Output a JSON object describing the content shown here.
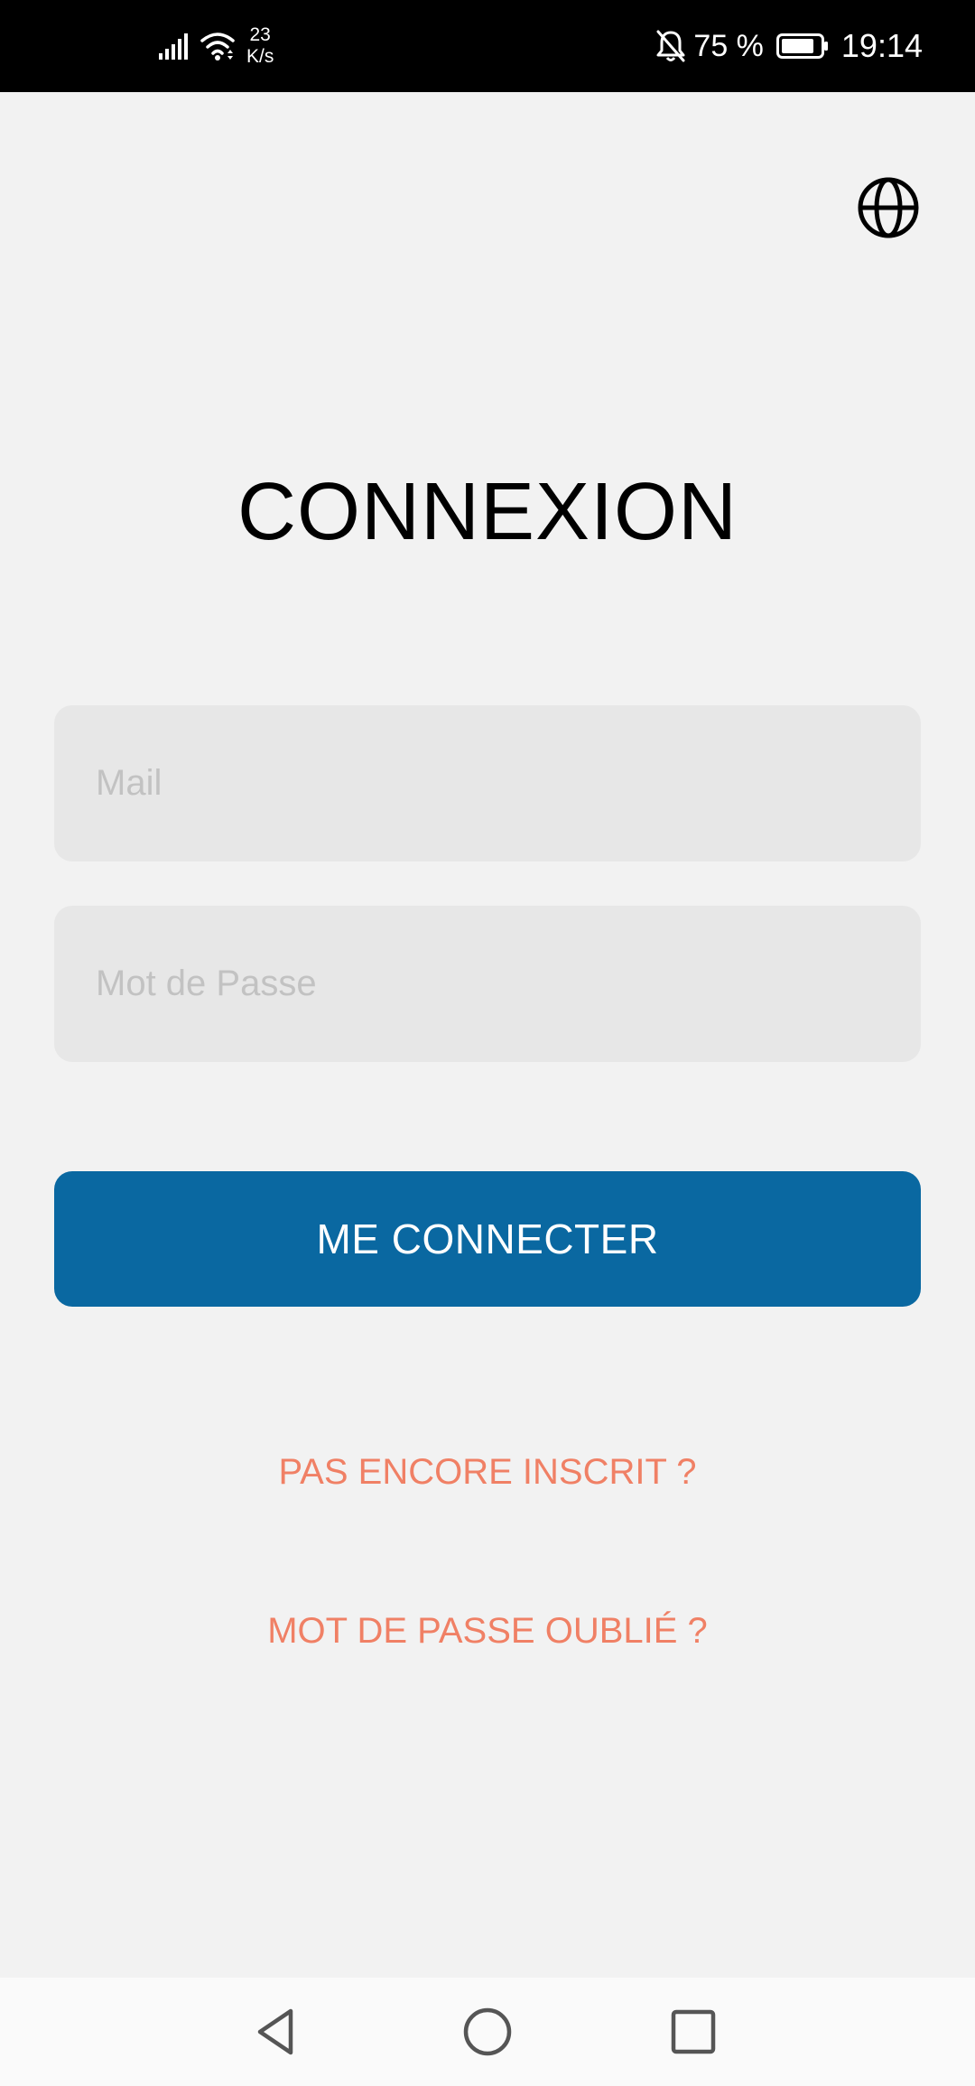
{
  "status_bar": {
    "signal_icon": "cellular-signal-icon",
    "wifi_icon": "wifi-icon",
    "net_speed_value": "23",
    "net_speed_unit": "K/s",
    "mute_icon": "notifications-off-icon",
    "battery_percent": "75 %",
    "battery_icon": "battery-icon",
    "time": "19:14"
  },
  "header": {
    "language_icon": "globe-icon"
  },
  "login": {
    "title": "CONNEXION",
    "email_placeholder": "Mail",
    "email_value": "",
    "password_placeholder": "Mot de Passe",
    "password_value": "",
    "submit_label": "ME CONNECTER",
    "register_link": "PAS ENCORE INSCRIT ?",
    "forgot_link": "MOT DE PASSE OUBLIÉ ?"
  },
  "colors": {
    "background": "#f2f2f2",
    "input_background": "#e7e7e7",
    "placeholder": "#c2c2c2",
    "primary_button": "#0a68a1",
    "link": "#f08065",
    "status_bar": "#000000"
  },
  "nav_bar": {
    "back_icon": "triangle-back-icon",
    "home_icon": "circle-home-icon",
    "recents_icon": "square-recents-icon"
  }
}
